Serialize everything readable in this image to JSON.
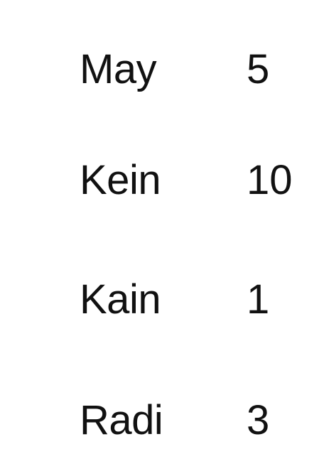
{
  "rows": [
    {
      "name": "May",
      "value": "5"
    },
    {
      "name": "Kein",
      "value": "10"
    },
    {
      "name": "Kain",
      "value": "1"
    },
    {
      "name": "Radi",
      "value": "3"
    }
  ],
  "colors": {
    "background": "#ffffff",
    "text": "#111111"
  }
}
